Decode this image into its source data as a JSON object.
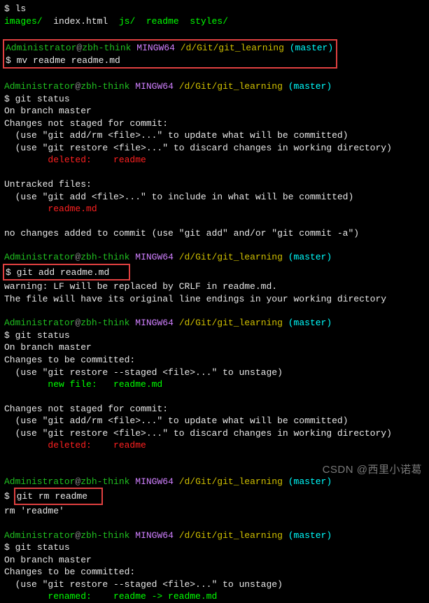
{
  "prompt": {
    "user": "Administrator",
    "at": "@",
    "host": "zbh-think",
    "env": "MINGW64",
    "path": "/d/Git/git_learning",
    "branch": "(master)",
    "dollar": "$"
  },
  "cmd": {
    "ls": "ls",
    "mv": "mv readme readme.md",
    "status": "git status",
    "add": "git add readme.md",
    "rm": "git rm readme",
    "rm_out": "rm 'readme'"
  },
  "ls_out": {
    "images": "images/",
    "index": "index.html",
    "js": "js/",
    "readme": "readme",
    "styles": "styles/"
  },
  "status1": {
    "branch": "On branch master",
    "not_staged": "Changes not staged for commit:",
    "hint1": "  (use \"git add/rm <file>...\" to update what will be committed)",
    "hint2": "  (use \"git restore <file>...\" to discard changes in working directory)",
    "deleted": "        deleted:    readme",
    "untracked": "Untracked files:",
    "hint3": "  (use \"git add <file>...\" to include in what will be committed)",
    "file": "        readme.md",
    "no_changes": "no changes added to commit (use \"git add\" and/or \"git commit -a\")"
  },
  "add_out": {
    "warn": "warning: LF will be replaced by CRLF in readme.md.",
    "warn2": "The file will have its original line endings in your working directory"
  },
  "status2": {
    "branch": "On branch master",
    "to_commit": "Changes to be committed:",
    "hint1": "  (use \"git restore --staged <file>...\" to unstage)",
    "new_file": "        new file:   readme.md",
    "not_staged": "Changes not staged for commit:",
    "hint2": "  (use \"git add/rm <file>...\" to update what will be committed)",
    "hint3": "  (use \"git restore <file>...\" to discard changes in working directory)",
    "deleted": "        deleted:    readme"
  },
  "status3": {
    "branch": "On branch master",
    "to_commit": "Changes to be committed:",
    "hint1": "  (use \"git restore --staged <file>...\" to unstage)",
    "renamed": "        renamed:    readme -> readme.md"
  },
  "watermark": "CSDN @西里小诺葛"
}
